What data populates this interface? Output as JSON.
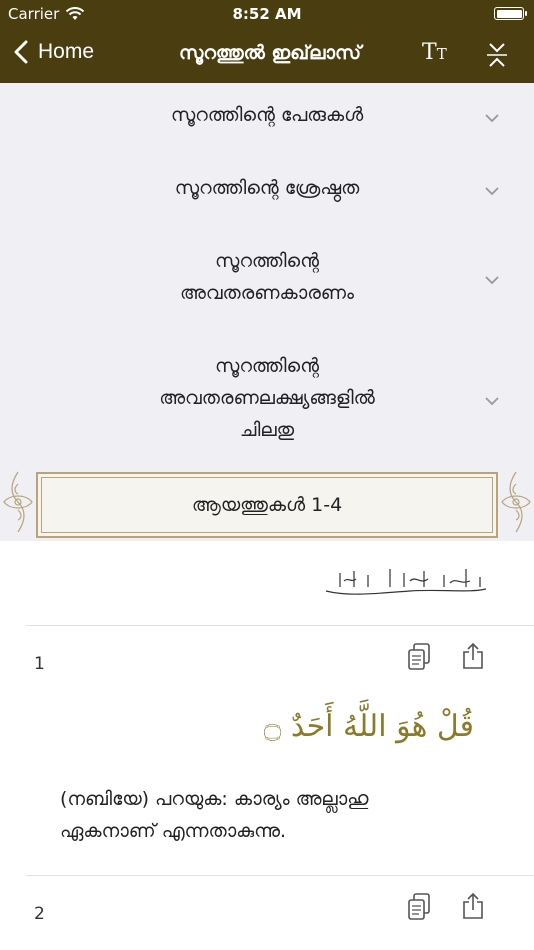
{
  "status_bar": {
    "carrier": "Carrier",
    "time": "8:52 AM"
  },
  "nav": {
    "back_label": "Home",
    "title": "സൂറത്തുൽ ഇഖ്‌ലാസ്",
    "text_size_icon": "text-size-icon",
    "collapse_icon": "collapse-icon"
  },
  "sections": [
    {
      "lines": [
        "സൂറത്തിന്റെ പേരുകൾ"
      ]
    },
    {
      "lines": [
        "സൂറത്തിന്റെ ശ്രേഷ്ഠത"
      ]
    },
    {
      "lines": [
        "സൂറത്തിന്റെ",
        "അവതരണകാരണം"
      ]
    },
    {
      "lines": [
        "സൂറത്തിന്റെ",
        "അവതരണലക്ഷ്യങ്ങളിൽ",
        "ചിലതു"
      ]
    }
  ],
  "ayah_header": {
    "label": "ആയത്തുകൾ 1-4"
  },
  "ayahs": [
    {
      "number": "1",
      "arabic": "قُلْ هُوَ اللَّهُ أَحَدٌ ۝",
      "translation_lines": [
        "(നബിയേ) പറയുക: കാര്യം അല്ലാഹു",
        "ഏകനാണ് എന്നതാകുന്നു."
      ]
    },
    {
      "number": "2"
    }
  ],
  "colors": {
    "header_bg": "#4a3d10",
    "section_bg": "#efeff4",
    "arabic_text": "#8a7a2a",
    "ornament": "#b9a37a"
  }
}
